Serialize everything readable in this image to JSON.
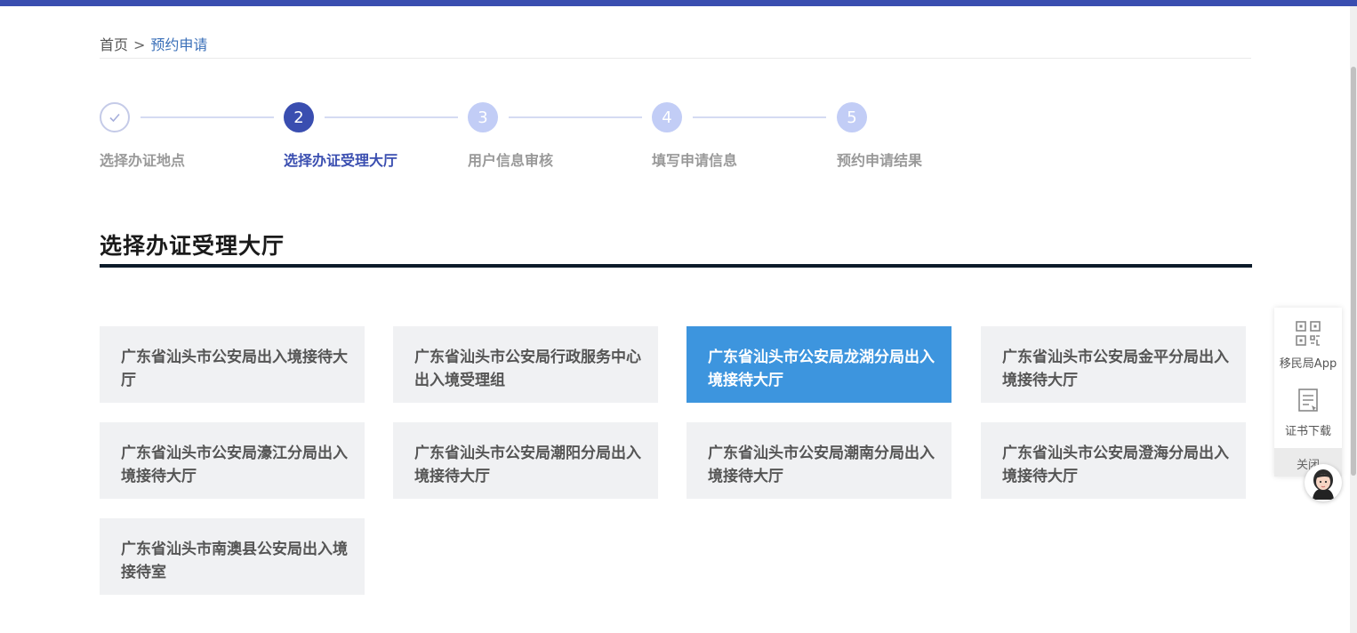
{
  "breadcrumb": {
    "home": "首页",
    "separator": ">",
    "current": "预约申请"
  },
  "steps": [
    {
      "number": "",
      "label": "选择办证地点",
      "state": "done"
    },
    {
      "number": "2",
      "label": "选择办证受理大厅",
      "state": "active"
    },
    {
      "number": "3",
      "label": "用户信息审核",
      "state": "todo"
    },
    {
      "number": "4",
      "label": "填写申请信息",
      "state": "todo"
    },
    {
      "number": "5",
      "label": "预约申请结果",
      "state": "todo"
    }
  ],
  "section": {
    "title": "选择办证受理大厅"
  },
  "halls": [
    {
      "name": "广东省汕头市公安局出入境接待大厅",
      "selected": false
    },
    {
      "name": "广东省汕头市公安局行政服务中心出入境受理组",
      "selected": false
    },
    {
      "name": "广东省汕头市公安局龙湖分局出入境接待大厅",
      "selected": true
    },
    {
      "name": "广东省汕头市公安局金平分局出入境接待大厅",
      "selected": false
    },
    {
      "name": "广东省汕头市公安局濠江分局出入境接待大厅",
      "selected": false
    },
    {
      "name": "广东省汕头市公安局潮阳分局出入境接待大厅",
      "selected": false
    },
    {
      "name": "广东省汕头市公安局潮南分局出入境接待大厅",
      "selected": false
    },
    {
      "name": "广东省汕头市公安局澄海分局出入境接待大厅",
      "selected": false
    },
    {
      "name": "广东省汕头市南澳县公安局出入境接待室",
      "selected": false
    }
  ],
  "side_panel": {
    "app_label": "移民局App",
    "cert_label": "证书下载",
    "close_label": "关闭"
  },
  "colors": {
    "accent": "#3a4eb0",
    "selected_hall": "#3d95de"
  }
}
